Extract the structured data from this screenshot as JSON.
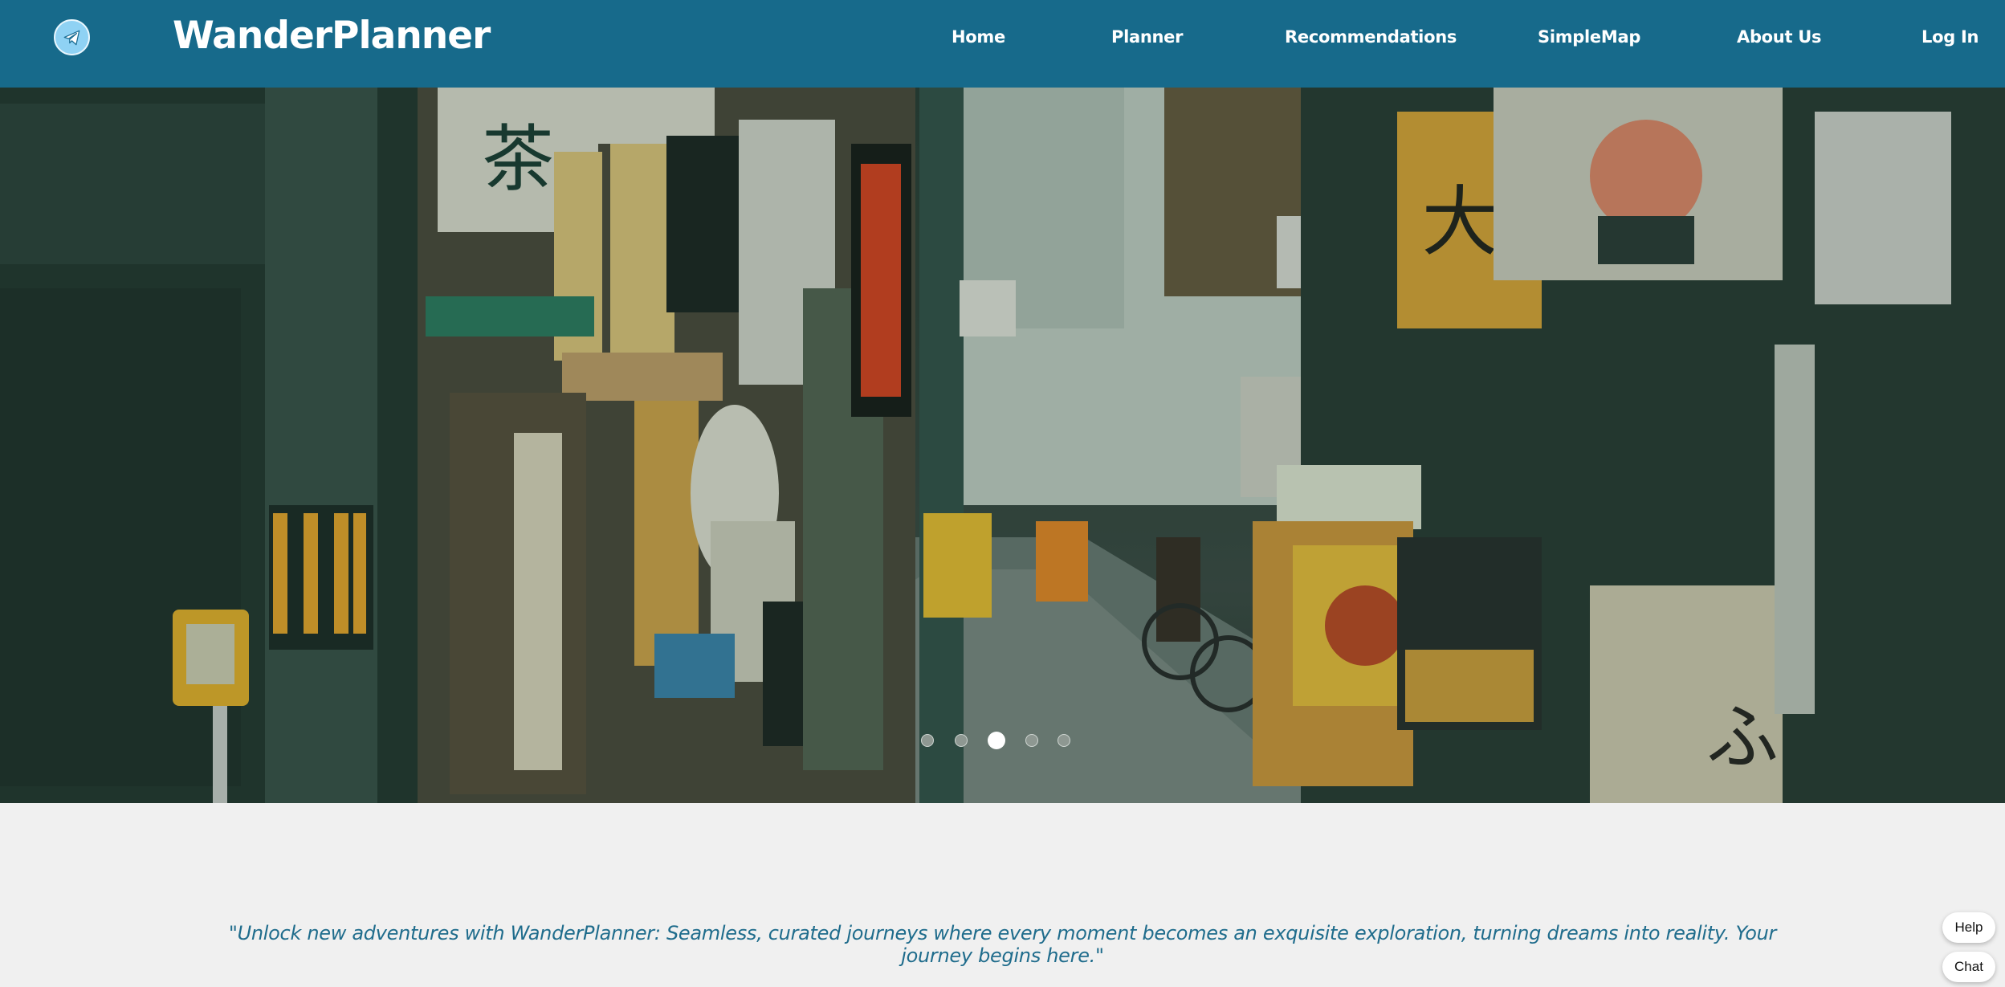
{
  "brand": {
    "name": "WanderPlanner",
    "logo_icon": "paper-plane-icon"
  },
  "nav": {
    "home": "Home",
    "planner": "Planner",
    "recommendations": "Recommendations",
    "simplemap": "SimpleMap",
    "about": "About Us",
    "login": "Log In"
  },
  "carousel": {
    "slide_count": 5,
    "active_index": 2
  },
  "tagline": "\"Unlock new adventures with WanderPlanner: Seamless, curated journeys where every moment becomes an exquisite exploration, turning dreams into reality. Your journey begins here.\"",
  "widgets": {
    "help": "Help",
    "chat": "Chat"
  },
  "colors": {
    "nav_bg": "#176a8b",
    "tagline": "#1f6c8c",
    "page_bg": "#f0f0f0"
  }
}
